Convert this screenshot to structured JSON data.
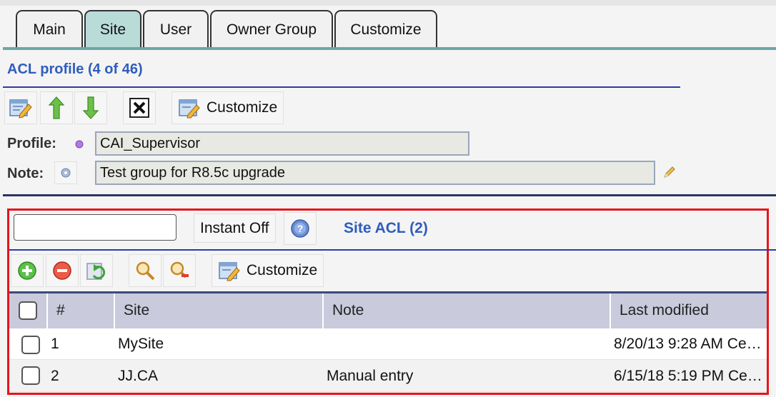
{
  "tabs": [
    {
      "label": "Main"
    },
    {
      "label": "Site",
      "active": true
    },
    {
      "label": "User"
    },
    {
      "label": "Owner Group"
    },
    {
      "label": "Customize"
    }
  ],
  "profile_section": {
    "title": "ACL profile (4 of 46)",
    "toolbar": {
      "icons": [
        "edit-form-icon",
        "move-up-icon",
        "move-down-icon",
        "close-icon"
      ],
      "customize_label": "Customize"
    },
    "profile_label": "Profile:",
    "profile_value": "CAI_Supervisor",
    "note_label": "Note:",
    "note_value": "Test group for R8.5c upgrade"
  },
  "acl_section": {
    "search": {
      "value": "",
      "placeholder": ""
    },
    "instant_label": "Instant Off",
    "title": "Site ACL (2)",
    "toolbar": {
      "icons": [
        "add-icon",
        "remove-icon",
        "refresh-icon",
        "search-icon",
        "clear-search-icon"
      ],
      "customize_label": "Customize"
    },
    "columns": [
      "#",
      "Site",
      "Note",
      "Last modified"
    ],
    "rows": [
      {
        "num": "1",
        "site": "MySite",
        "note": "",
        "modified": "8/20/13 9:28 AM Ce…"
      },
      {
        "num": "2",
        "site": "JJ.CA",
        "note": "Manual entry",
        "modified": "6/15/18 5:19 PM Ce…"
      }
    ]
  },
  "colors": {
    "accent_blue": "#2f5dbd",
    "active_tab": "#b9dcd9",
    "highlight_border": "#e5141b",
    "header_bg": "#c9cadc"
  }
}
